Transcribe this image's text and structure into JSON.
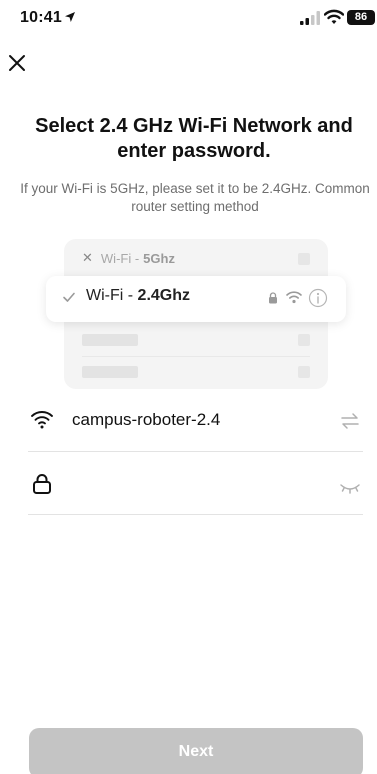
{
  "status_bar": {
    "time": "10:41",
    "battery": "86",
    "icons": [
      "location-arrow-icon",
      "cellular-signal-icon",
      "wifi-icon",
      "battery-icon"
    ]
  },
  "header": {
    "close_icon": "close-icon"
  },
  "title": "Select 2.4 GHz Wi-Fi Network and enter password.",
  "subtitle": "If your Wi-Fi is 5GHz, please set it to be 2.4GHz. Common router setting method",
  "illustration": {
    "row_5g_prefix": "Wi-Fi -",
    "row_5g_band": "5Ghz",
    "row_24_prefix": "Wi-Fi -",
    "row_24_band": "2.4Ghz",
    "icons": [
      "x-icon",
      "check-icon",
      "lock-icon",
      "wifi-icon",
      "info-icon"
    ]
  },
  "ssid_field": {
    "icon": "wifi-icon",
    "value": "campus-roboter-2.4",
    "action_icon": "switch-network-icon"
  },
  "password_field": {
    "icon": "lock-icon",
    "value": "",
    "placeholder": "",
    "action_icon": "eye-closed-icon"
  },
  "next_button": {
    "label": "Next",
    "enabled": false
  },
  "colors": {
    "text": "#111111",
    "muted": "#6e6e6e",
    "button_disabled": "#c4c4c4",
    "divider": "#e3e3e3"
  }
}
